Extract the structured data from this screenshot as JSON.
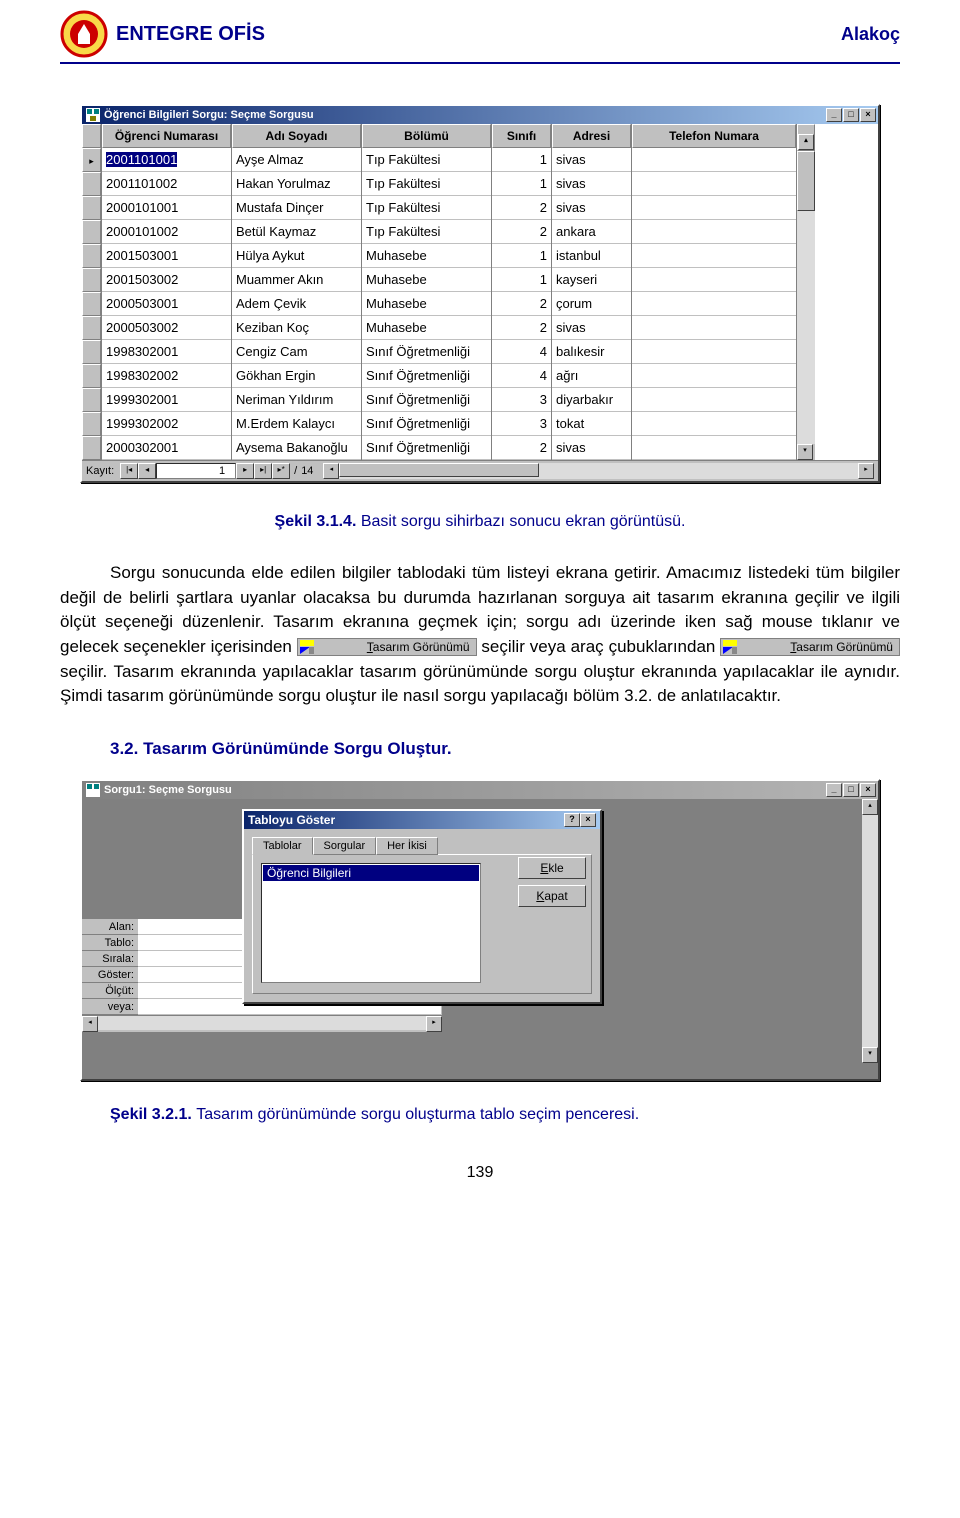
{
  "header": {
    "title": "ENTEGRE OFİS",
    "author": "Alakoç"
  },
  "window1": {
    "title": "Öğrenci Bilgileri Sorgu: Seçme Sorgusu",
    "columns": [
      "Öğrenci Numarası",
      "Adı Soyadı",
      "Bölümü",
      "Sınıfı",
      "Adresi",
      "Telefon Numara"
    ],
    "rows": [
      {
        "ogrno": "2001101001",
        "ad": "Ayşe Almaz",
        "bolum": "Tıp Fakültesi",
        "sinif": "1",
        "adres": "sivas"
      },
      {
        "ogrno": "2001101002",
        "ad": "Hakan Yorulmaz",
        "bolum": "Tıp Fakültesi",
        "sinif": "1",
        "adres": "sivas"
      },
      {
        "ogrno": "2000101001",
        "ad": "Mustafa Dinçer",
        "bolum": "Tıp Fakültesi",
        "sinif": "2",
        "adres": "sivas"
      },
      {
        "ogrno": "2000101002",
        "ad": "Betül Kaymaz",
        "bolum": "Tıp Fakültesi",
        "sinif": "2",
        "adres": "ankara"
      },
      {
        "ogrno": "2001503001",
        "ad": "Hülya Aykut",
        "bolum": "Muhasebe",
        "sinif": "1",
        "adres": "istanbul"
      },
      {
        "ogrno": "2001503002",
        "ad": "Muammer Akın",
        "bolum": "Muhasebe",
        "sinif": "1",
        "adres": "kayseri"
      },
      {
        "ogrno": "2000503001",
        "ad": "Adem Çevik",
        "bolum": "Muhasebe",
        "sinif": "2",
        "adres": "çorum"
      },
      {
        "ogrno": "2000503002",
        "ad": "Keziban Koç",
        "bolum": "Muhasebe",
        "sinif": "2",
        "adres": "sivas"
      },
      {
        "ogrno": "1998302001",
        "ad": "Cengiz Cam",
        "bolum": "Sınıf Öğretmenliği",
        "sinif": "4",
        "adres": "balıkesir"
      },
      {
        "ogrno": "1998302002",
        "ad": "Gökhan Ergin",
        "bolum": "Sınıf Öğretmenliği",
        "sinif": "4",
        "adres": "ağrı"
      },
      {
        "ogrno": "1999302001",
        "ad": "Neriman Yıldırım",
        "bolum": "Sınıf Öğretmenliği",
        "sinif": "3",
        "adres": "diyarbakır"
      },
      {
        "ogrno": "1999302002",
        "ad": "M.Erdem Kalaycı",
        "bolum": "Sınıf Öğretmenliği",
        "sinif": "3",
        "adres": "tokat"
      },
      {
        "ogrno": "2000302001",
        "ad": "Aysema Bakanoğlu",
        "bolum": "Sınıf Öğretmenliği",
        "sinif": "2",
        "adres": "sivas"
      }
    ],
    "recnav": {
      "label": "Kayıt:",
      "current": "1",
      "total": "14",
      "sep": "/"
    }
  },
  "caption1": "Şekil 3.1.4. ",
  "caption1text": "Basit sorgu sihirbazı sonucu ekran görüntüsü.",
  "body": {
    "p1": "Sorgu sonucunda elde edilen bilgiler tablodaki tüm listeyi ekrana getirir. Amacımız listedeki tüm bilgiler değil de belirli şartlara uyanlar olacaksa bu durumda hazırlanan sorguya ait tasarım ekranına geçilir ve ilgili ölçüt seçeneği düzenlenir. Tasarım ekranına geçmek için; sorgu adı üzerinde iken sağ mouse tıklanır ve gelecek seçenekler içerisinden ",
    "p1mid": " seçilir veya araç çubuklarından ",
    "p1end": " seçilir. Tasarım ekranında yapılacaklar  tasarım görünümünde sorgu oluştur ekranında yapılacaklar ile aynıdır. Şimdi tasarım görünümünde sorgu oluştur ile nasıl sorgu yapılacağı bölüm 3.2. de anlatılacaktır.",
    "chip": "Tasarım Görünümü",
    "chipT": "T"
  },
  "section": "3.2. Tasarım Görünümünde Sorgu Oluştur.",
  "window2": {
    "title": "Sorgu1: Seçme Sorgusu",
    "grid_labels": [
      "Alan:",
      "Tablo:",
      "Sırala:",
      "Göster:",
      "Ölçüt:",
      "veya:"
    ]
  },
  "dialog": {
    "title": "Tabloyu Göster",
    "tabs": [
      "Tablolar",
      "Sorgular",
      "Her İkisi"
    ],
    "listitem": "Öğrenci Bilgileri",
    "btn_add": "Ekle",
    "btn_close": "Kapat",
    "btn_add_u": "E",
    "btn_close_u": "K"
  },
  "caption2": "Şekil 3.2.1. ",
  "caption2text": "Tasarım görünümünde sorgu oluşturma tablo seçim penceresi.",
  "pagenum": "139"
}
